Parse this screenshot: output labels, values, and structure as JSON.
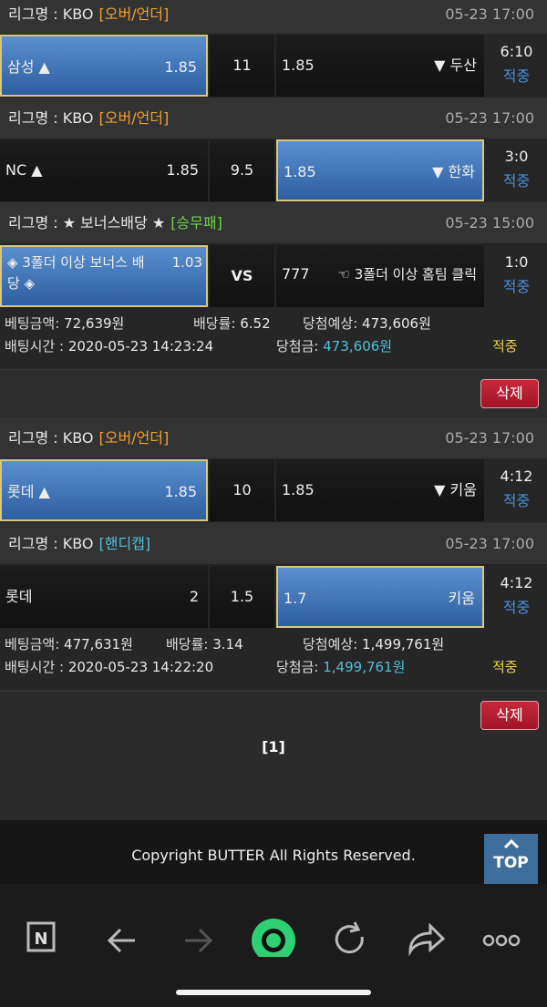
{
  "groups": [
    {
      "league": "리그명 : KBO",
      "type": "[오버/언더]",
      "time": "05-23 17:00",
      "home": "삼성 ▲",
      "home_odd": "1.85",
      "mid": "11",
      "away_odd": "1.85",
      "away": "▼ 두산",
      "score": "6:10",
      "result": "적중"
    },
    {
      "league": "리그명 : KBO",
      "type": "[오버/언더]",
      "time": "05-23 17:00",
      "home": "NC ▲",
      "home_odd": "1.85",
      "mid": "9.5",
      "away_odd": "1.85",
      "away": "▼ 한화",
      "score": "3:0",
      "result": "적중"
    },
    {
      "league": "리그명 : ★ 보너스배당 ★",
      "type": "[승무패]",
      "time": "05-23 15:00",
      "home_line1": "◈ 3폴더 이상 보너스 배",
      "home_line2": "당 ◈",
      "home_odd": "1.03",
      "mid": "VS",
      "away_odd": "777",
      "away": "☜ 3폴더 이상 홈팀 클릭",
      "score": "1:0",
      "result": "적중"
    },
    {
      "league": "리그명 : KBO",
      "type": "[오버/언더]",
      "time": "05-23 17:00",
      "home": "롯데 ▲",
      "home_odd": "1.85",
      "mid": "10",
      "away_odd": "1.85",
      "away": "▼ 키움",
      "score": "4:12",
      "result": "적중"
    },
    {
      "league": "리그명 : KBO",
      "type": "[핸디캡]",
      "time": "05-23 17:00",
      "home": "롯데",
      "home_odd": "2",
      "mid": "1.5",
      "away_odd": "1.7",
      "away": "키움",
      "score": "4:12",
      "result": "적중"
    }
  ],
  "bets": [
    {
      "amount_label": "베팅금액:",
      "amount": "72,639원",
      "rate_label": "배당률:",
      "rate": "6.52",
      "expect_label": "당첨예상:",
      "expect": "473,606원",
      "time_label": "배팅시간 :",
      "time": "2020-05-23 14:23:24",
      "win_label": "당첨금:",
      "win": "473,606원",
      "status": "적중",
      "delete": "삭제"
    },
    {
      "amount_label": "베팅금액:",
      "amount": "477,631원",
      "rate_label": "배당률:",
      "rate": "3.14",
      "expect_label": "당첨예상:",
      "expect": "1,499,761원",
      "time_label": "배팅시간 :",
      "time": "2020-05-23 14:22:20",
      "win_label": "당첨금:",
      "win": "1,499,761원",
      "status": "적중",
      "delete": "삭제"
    }
  ],
  "pager": "[1]",
  "footer": {
    "copyright": "Copyright BUTTER All Rights Reserved.",
    "top": "TOP"
  },
  "browser": {
    "icons": [
      "naver-n-icon",
      "back-arrow-icon",
      "forward-arrow-icon",
      "green-dot-home-icon",
      "reload-icon",
      "share-icon",
      "more-dots-icon"
    ],
    "n_letter": "N"
  }
}
